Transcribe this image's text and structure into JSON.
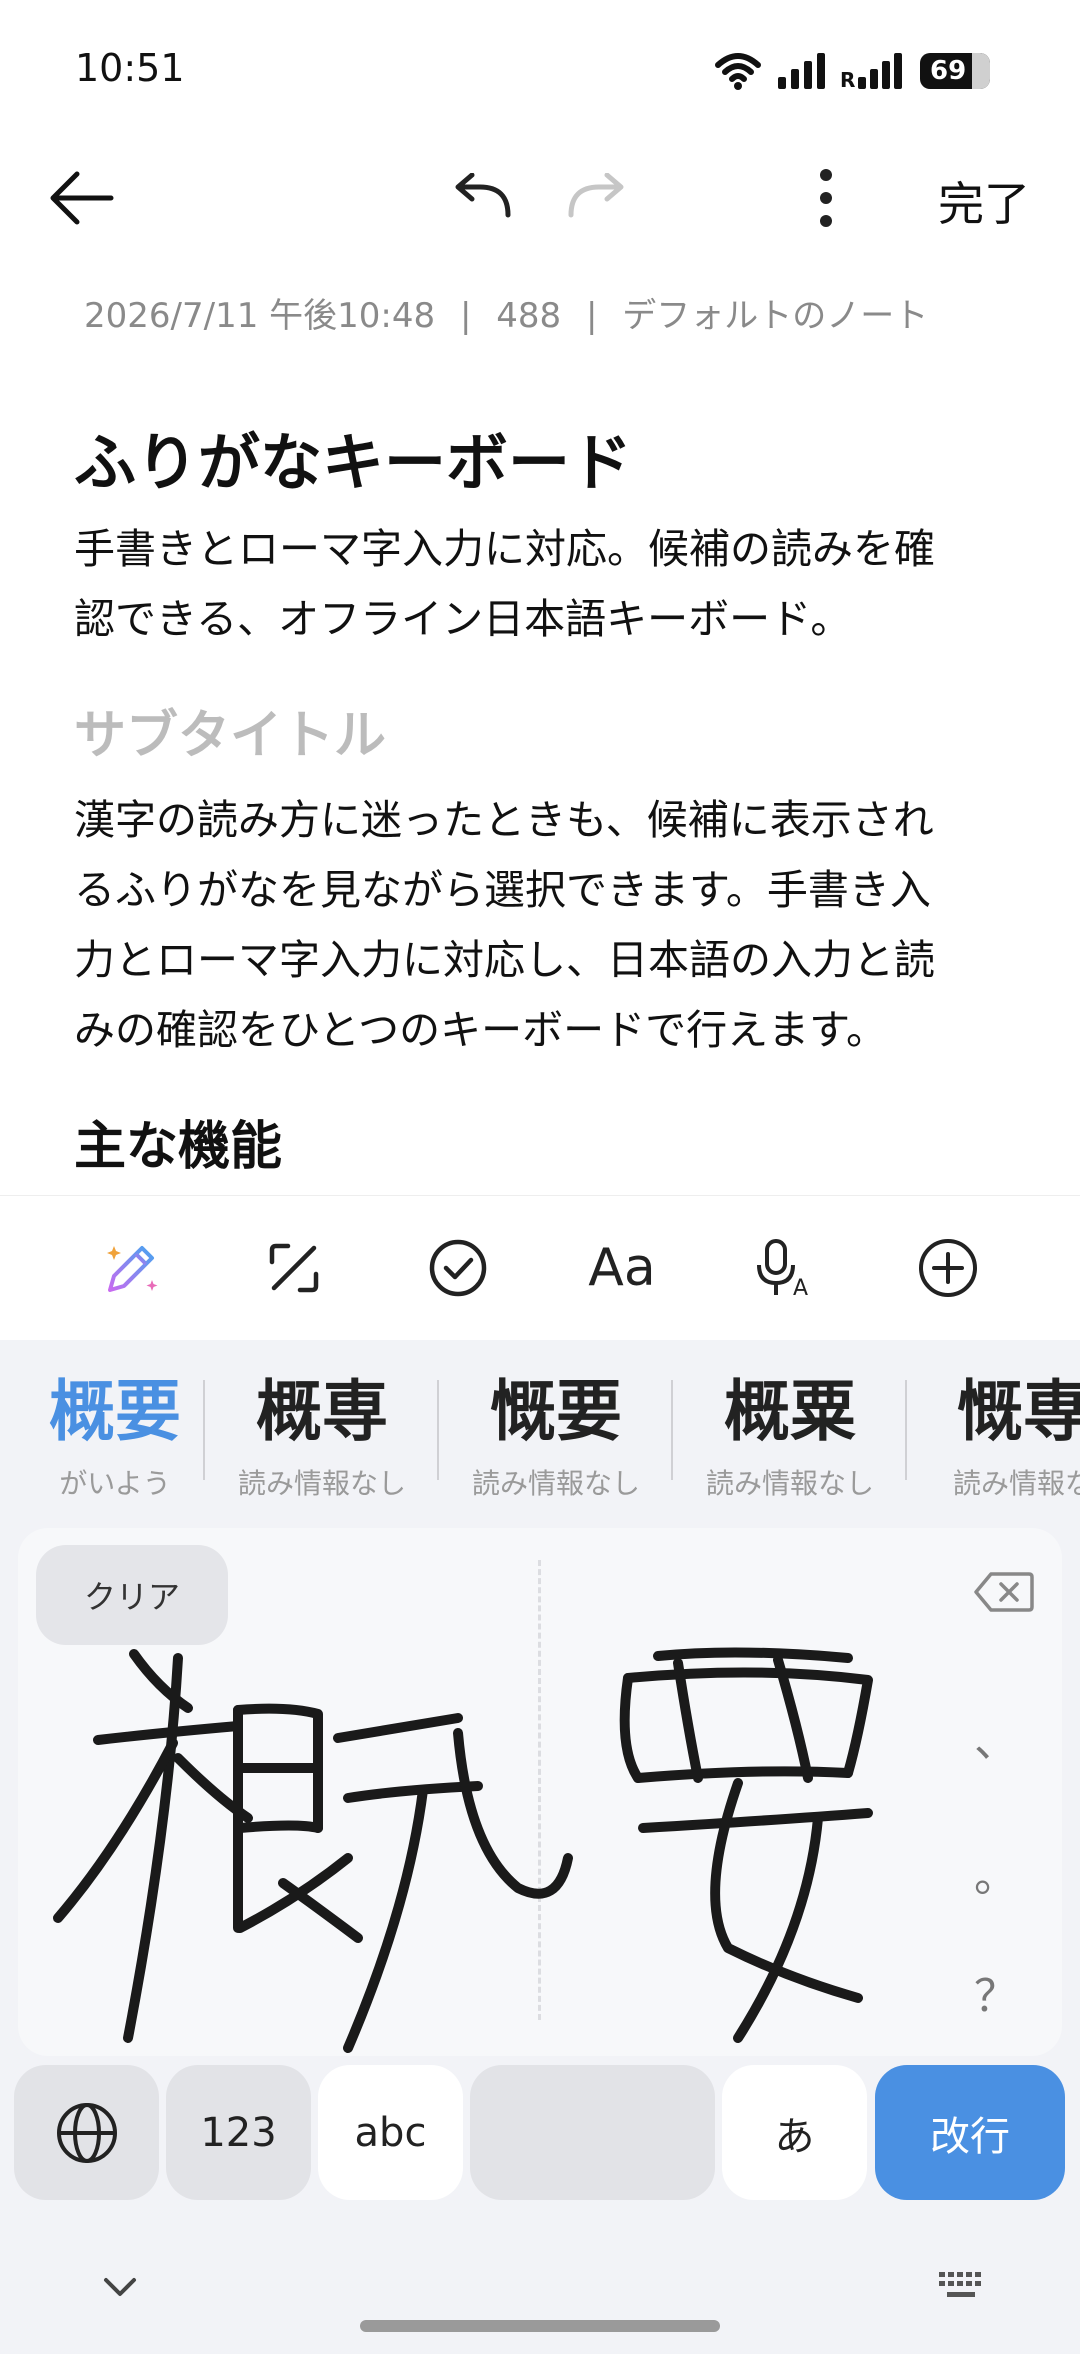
{
  "status": {
    "time": "10:51",
    "battery": "69"
  },
  "toolbar": {
    "done_label": "完了"
  },
  "meta": {
    "date": "2026/7/11 午後10:48",
    "count": "488",
    "folder": "デフォルトのノート"
  },
  "note": {
    "title": "ふりがなキーボード",
    "intro_lines": [
      "手書きとローマ字入力に対応。候補の読みを確",
      "認できる、オフライン日本語キーボード。"
    ],
    "subtitle": "サブタイトル",
    "body_lines": [
      "漢字の読み方に迷ったときも、候補に表示され",
      "るふりがなを見ながら選択できます。手書き入",
      "力とローマ字入力に対応し、日本語の入力と読",
      "みの確認をひとつのキーボードで行えます。"
    ],
    "heading2": "主な機能"
  },
  "format_bar": {
    "font_label": "Aa"
  },
  "keyboard": {
    "candidates": [
      {
        "kanji": "概要",
        "reading": "がいよう"
      },
      {
        "kanji": "概専",
        "reading": "読み情報なし"
      },
      {
        "kanji": "慨要",
        "reading": "読み情報なし"
      },
      {
        "kanji": "概粟",
        "reading": "読み情報なし"
      },
      {
        "kanji": "慨専",
        "reading": "読み情報な"
      }
    ],
    "clear_label": "クリア",
    "punct": [
      "、",
      "。",
      "？"
    ],
    "keys": {
      "num": "123",
      "abc": "abc",
      "kana": "あ",
      "enter": "改行"
    }
  },
  "colors": {
    "accent": "#4a90e2",
    "keyboard_bg": "#f2f3f7"
  }
}
